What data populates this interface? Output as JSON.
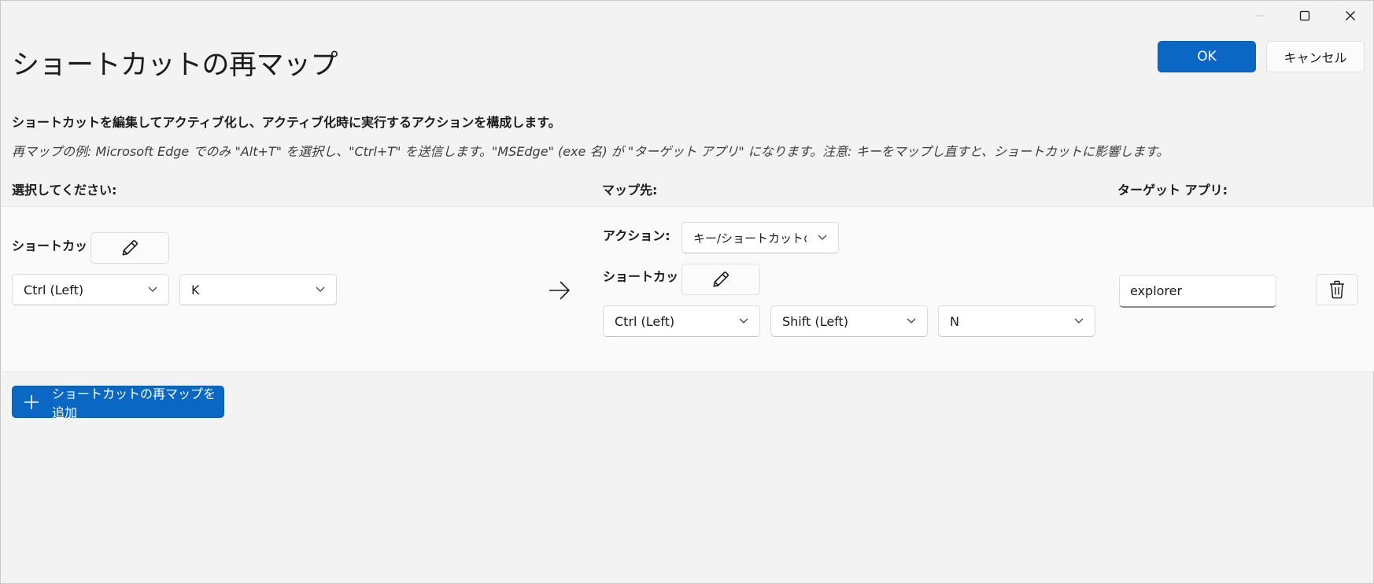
{
  "window": {
    "title": "ショートカットの再マップ",
    "caption": {
      "minimize_icon": "minimize-icon",
      "maximize_icon": "maximize-icon",
      "close_icon": "close-icon"
    }
  },
  "header": {
    "ok_label": "OK",
    "cancel_label": "キャンセル"
  },
  "description": "ショートカットを編集してアクティブ化し、アクティブ化時に実行するアクションを構成します。",
  "example": "再マップの例: Microsoft Edge でのみ \"Alt+T\" を選択し、\"Ctrl+T\" を送信します。\"MSEdge\" (exe 名) が \"ターゲット アプリ\" になります。注意: キーをマップし直すと、ショートカットに影響します。",
  "columns": {
    "select": "選択してください:",
    "map_to": "マップ先:",
    "target_app": "ターゲット アプリ:"
  },
  "row": {
    "source": {
      "shortcut_label": "ショートカット:",
      "keys": [
        "Ctrl (Left)",
        "K"
      ]
    },
    "destination": {
      "action_label": "アクション:",
      "action_value": "キー/ショートカットの送信",
      "shortcut_label": "ショートカット:",
      "keys": [
        "Ctrl (Left)",
        "Shift (Left)",
        "N"
      ]
    },
    "target_app_value": "explorer"
  },
  "add_button_label": "ショートカットの再マップを追加",
  "colors": {
    "accent": "#0a67c3",
    "background": "#f3f3f3",
    "row_background": "#fafafa"
  }
}
